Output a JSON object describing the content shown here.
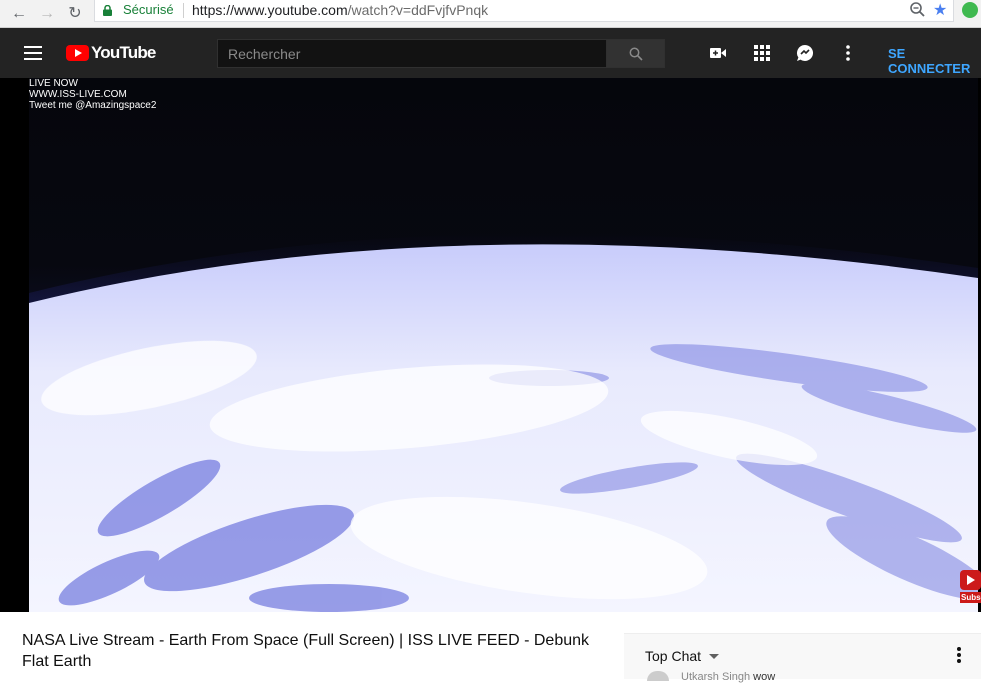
{
  "browser": {
    "secure_label": "Sécurisé",
    "url_base": "https://www.youtube.com",
    "url_rest": "/watch?v=ddFvjfvPnqk"
  },
  "masthead": {
    "logo_text": "YouTube",
    "search_placeholder": "Rechercher",
    "signin_label": "SE CONNECTER",
    "icons": [
      "menu-icon",
      "upload-video-icon",
      "apps-icon",
      "messages-icon",
      "more-icon",
      "search-icon"
    ]
  },
  "video": {
    "overlay_lines": [
      "LIVE NOW",
      "WWW.ISS-LIVE.COM",
      "Tweet me @Amazingspace2"
    ],
    "watermark_label": "Subscribe",
    "title": "NASA Live Stream - Earth From Space (Full Screen) | ISS LIVE FEED - Debunk Flat Earth"
  },
  "chat": {
    "mode_label": "Top Chat",
    "peek_author": "Utkarsh Singh",
    "peek_message": "wow"
  },
  "colors": {
    "masthead_bg": "#232323",
    "brand_red": "#ff0000",
    "signin_blue": "#3ea6ff",
    "secure_green": "#188038"
  }
}
